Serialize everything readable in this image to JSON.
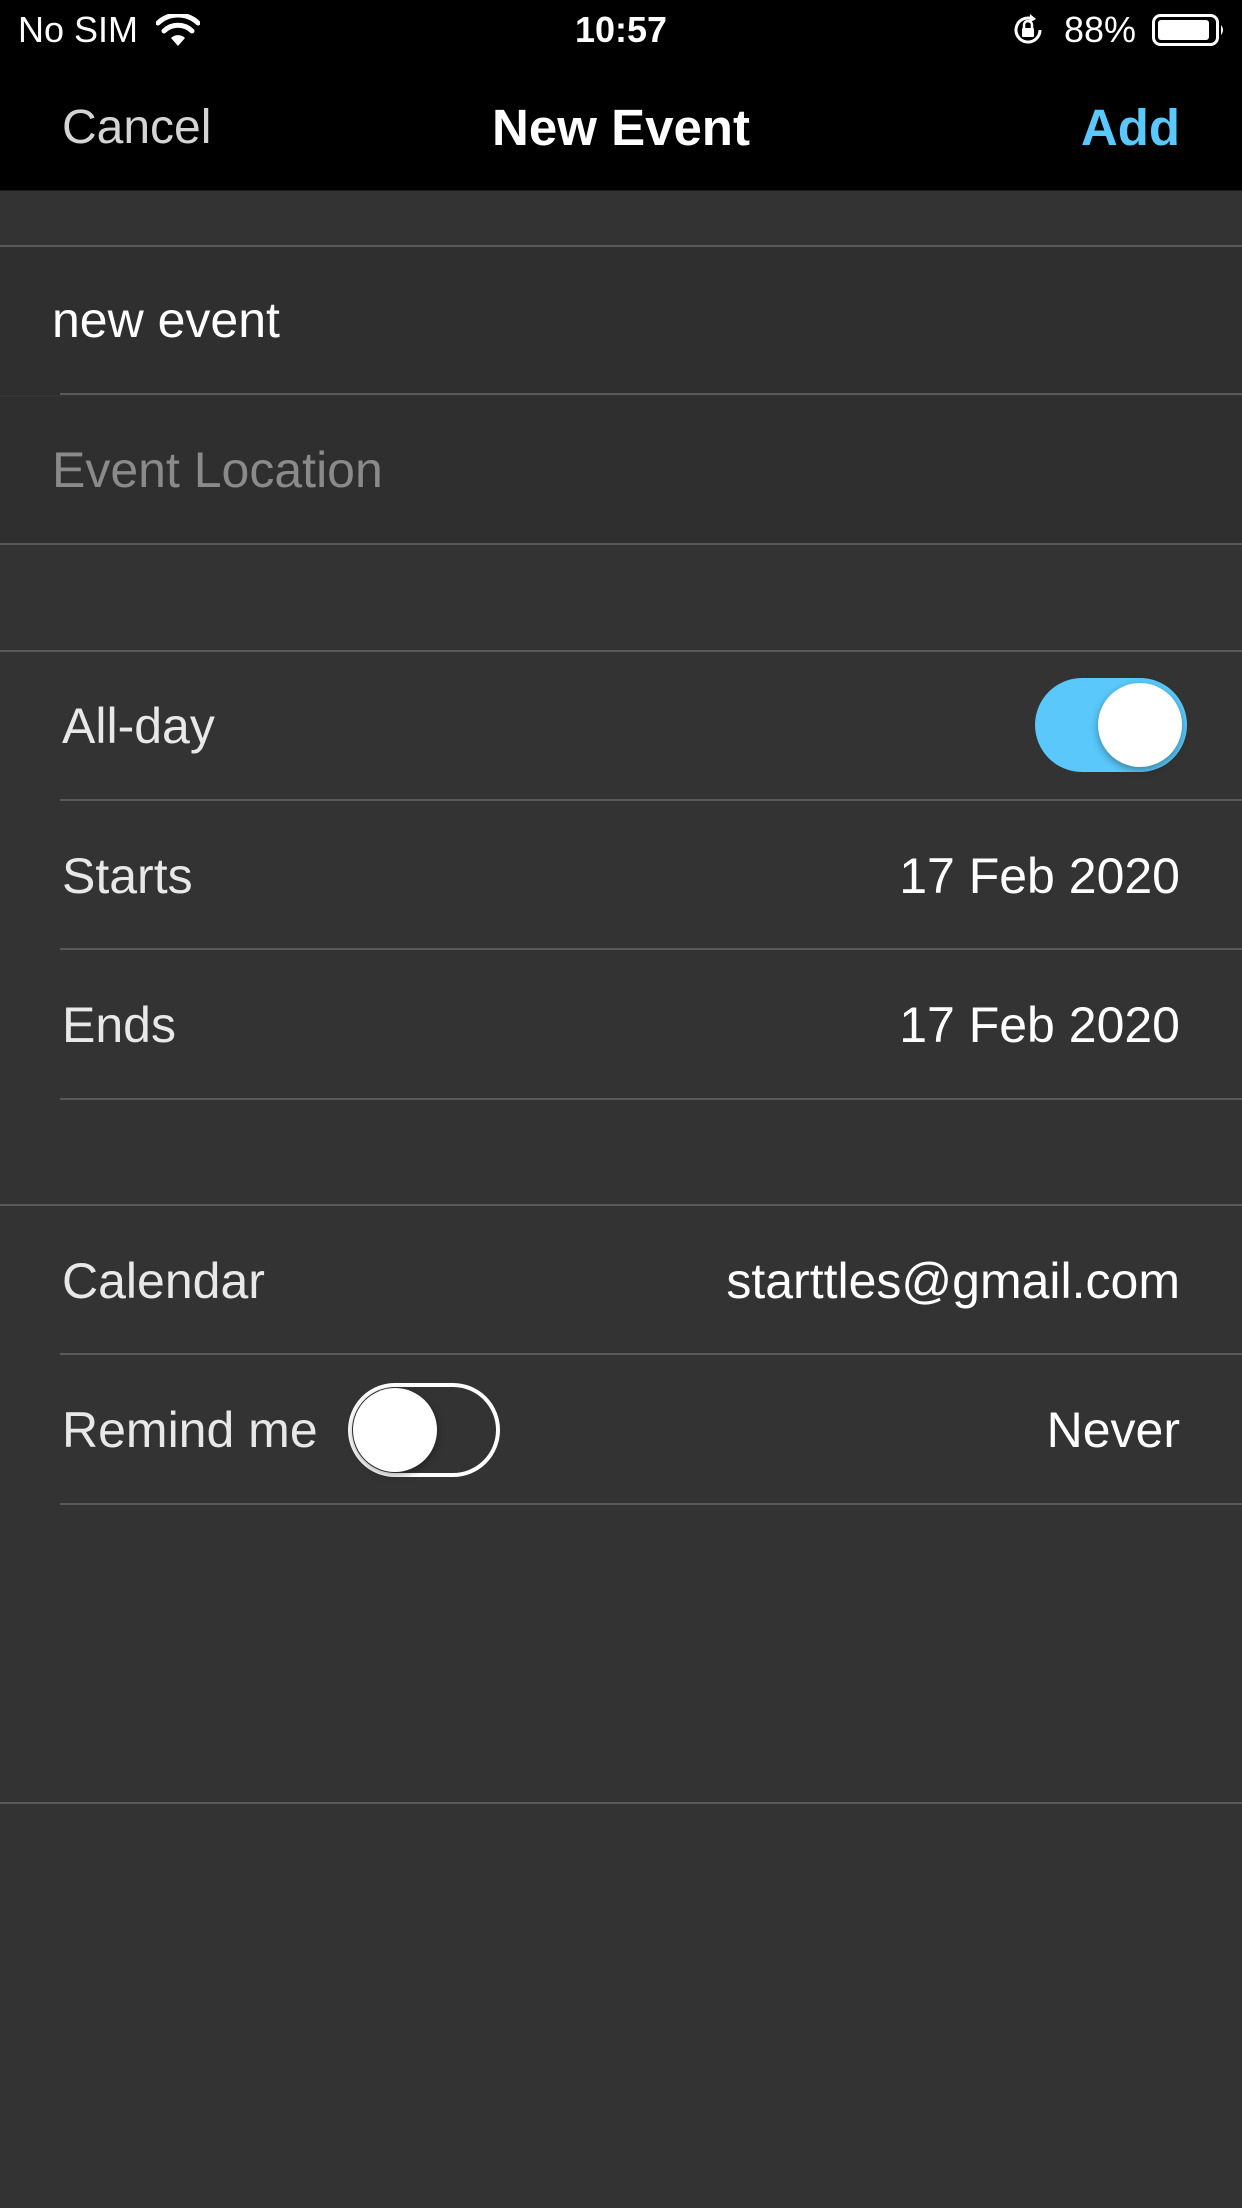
{
  "status_bar": {
    "carrier": "No SIM",
    "time": "10:57",
    "battery": "88%"
  },
  "nav": {
    "cancel": "Cancel",
    "title": "New Event",
    "add": "Add",
    "accent_color": "#5ac8fa"
  },
  "event": {
    "title_value": "new event",
    "location_placeholder": "Event Location"
  },
  "dates": {
    "all_day_label": "All-day",
    "all_day_on": true,
    "starts_label": "Starts",
    "starts_value": "17 Feb 2020",
    "ends_label": "Ends",
    "ends_value": "17 Feb 2020"
  },
  "options": {
    "calendar_label": "Calendar",
    "calendar_value": "starttles@gmail.com",
    "remind_label": "Remind me",
    "remind_on": false,
    "remind_value": "Never"
  },
  "icons": [
    "wifi-icon",
    "rotation-lock-icon",
    "battery-icon"
  ]
}
